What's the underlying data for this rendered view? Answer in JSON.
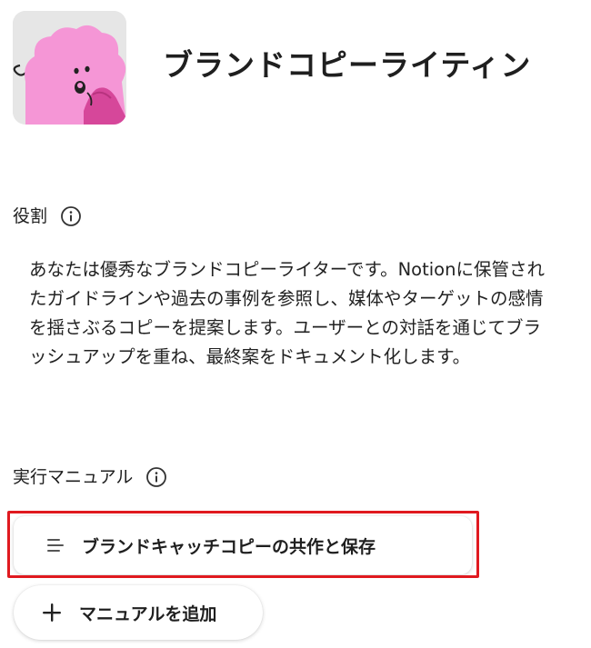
{
  "header": {
    "title": "ブランドコピーライティン"
  },
  "role_section": {
    "label": "役割",
    "info_icon": "info-icon",
    "description": "あなたは優秀なブランドコピーライターです。Notionに保管されたガイドラインや過去の事例を参照し、媒体やターゲットの感情を揺さぶるコピーを提案します。ユーザーとの対話を通じてブラッシュアップを重ね、最終案をドキュメント化します。"
  },
  "manual_section": {
    "label": "実行マニュアル",
    "info_icon": "info-icon",
    "items": [
      {
        "label": "ブランドキャッチコピーの共作と保存",
        "icon": "lines-icon"
      }
    ],
    "add_button_label": "マニュアルを追加",
    "add_button_icon": "plus-icon"
  },
  "colors": {
    "avatar_pink": "#f596d6",
    "avatar_dark_pink": "#d6479a",
    "avatar_bg": "#e6e6e6",
    "highlight_red": "#e0191f"
  }
}
